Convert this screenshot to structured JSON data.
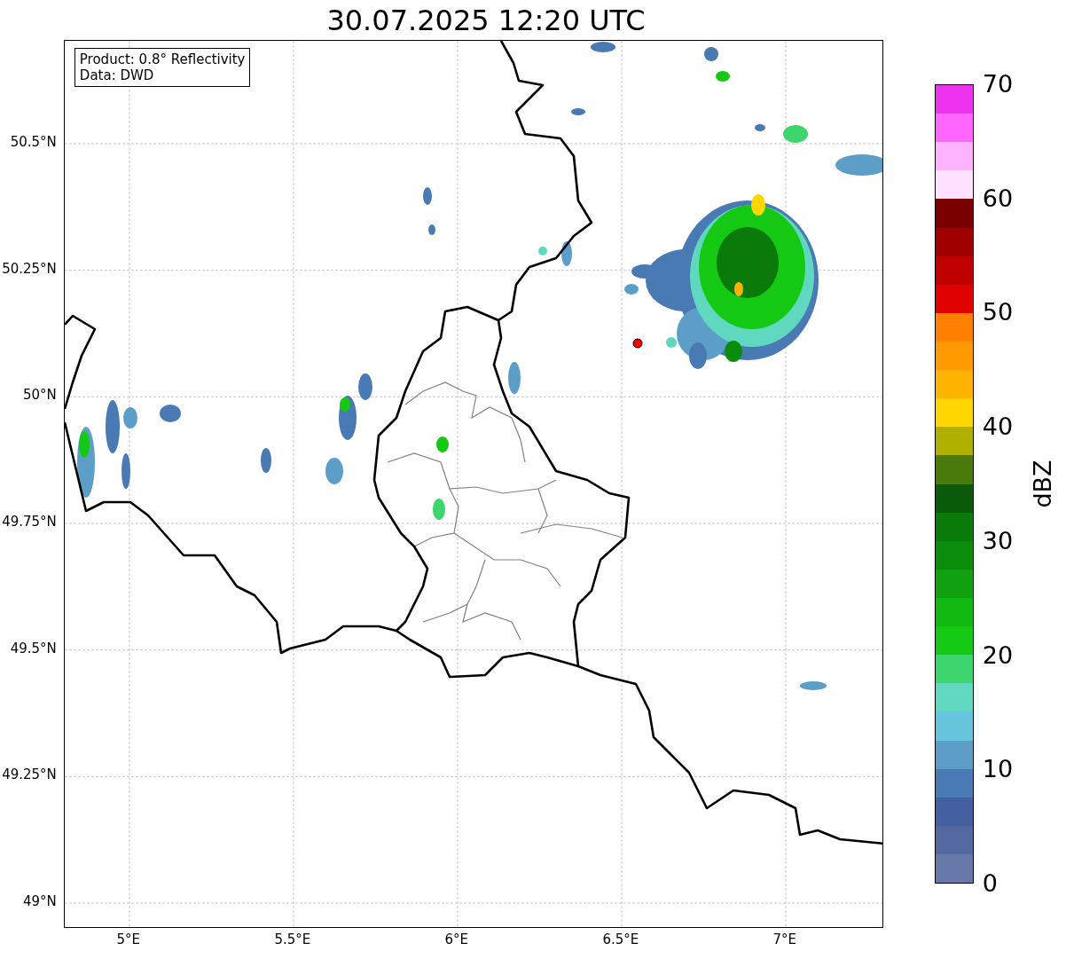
{
  "title": "30.07.2025 12:20 UTC",
  "info_box": [
    "Product: 0.8° Reflectivity",
    "Data: DWD"
  ],
  "map": {
    "y_ticks": [
      "50.5°N",
      "50.25°N",
      "50°N",
      "49.75°N",
      "49.5°N",
      "49.25°N",
      "49°N"
    ],
    "x_ticks": [
      "5°E",
      "5.5°E",
      "6°E",
      "6.5°E",
      "7°E"
    ]
  },
  "colorbar": {
    "label": "dBZ",
    "ticks": [
      "70",
      "60",
      "50",
      "40",
      "30",
      "20",
      "10",
      "0"
    ],
    "bins": [
      {
        "color": "#6878a8"
      },
      {
        "color": "#5468a0"
      },
      {
        "color": "#4460a0"
      },
      {
        "color": "#4a7ab4"
      },
      {
        "color": "#5c9ec8"
      },
      {
        "color": "#66c4dc"
      },
      {
        "color": "#60d8c0"
      },
      {
        "color": "#3dd66e"
      },
      {
        "color": "#14c814"
      },
      {
        "color": "#10b810"
      },
      {
        "color": "#10a010"
      },
      {
        "color": "#0c8c0c"
      },
      {
        "color": "#0a7a0a"
      },
      {
        "color": "#0a5a0a"
      },
      {
        "color": "#4a7a0a"
      },
      {
        "color": "#b0b000"
      },
      {
        "color": "#ffd700"
      },
      {
        "color": "#ffb300"
      },
      {
        "color": "#ff9a00"
      },
      {
        "color": "#ff7f00"
      },
      {
        "color": "#e00000"
      },
      {
        "color": "#c00000"
      },
      {
        "color": "#a00000"
      },
      {
        "color": "#7a0000"
      },
      {
        "color": "#ffe0ff"
      },
      {
        "color": "#ffb3ff"
      },
      {
        "color": "#ff66ff"
      },
      {
        "color": "#ee33ee"
      }
    ]
  }
}
